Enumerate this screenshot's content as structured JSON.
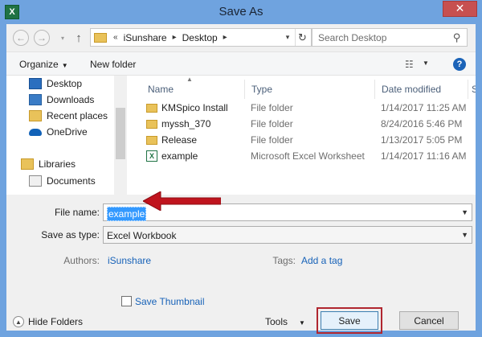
{
  "window": {
    "title": "Save As",
    "app_icon_letter": "X",
    "close_glyph": "✕"
  },
  "address": {
    "back_glyph": "←",
    "forward_glyph": "→",
    "up_glyph": "↑",
    "prefix": "«",
    "crumbs": [
      "iSunshare",
      "Desktop"
    ],
    "refresh_glyph": "↻",
    "search_placeholder": "Search Desktop"
  },
  "toolbar": {
    "organize": "Organize",
    "new_folder": "New folder",
    "help": "?"
  },
  "nav_pane": {
    "items": [
      {
        "label": "Desktop",
        "icon": "desktop-icon"
      },
      {
        "label": "Downloads",
        "icon": "downloads-icon"
      },
      {
        "label": "Recent places",
        "icon": "recent-places-icon"
      },
      {
        "label": "OneDrive",
        "icon": "onedrive-icon"
      },
      {
        "label": "Libraries",
        "icon": "libraries-icon"
      },
      {
        "label": "Documents",
        "icon": "documents-icon"
      }
    ]
  },
  "file_list": {
    "columns": [
      "Name",
      "Type",
      "Date modified",
      "Siz"
    ],
    "rows": [
      {
        "name": "KMSpico Install",
        "type": "File folder",
        "date": "1/14/2017 11:25 AM",
        "icon": "folder-icon"
      },
      {
        "name": "myssh_370",
        "type": "File folder",
        "date": "8/24/2016 5:46 PM",
        "icon": "folder-icon"
      },
      {
        "name": "Release",
        "type": "File folder",
        "date": "1/13/2017 5:05 PM",
        "icon": "folder-icon"
      },
      {
        "name": "example",
        "type": "Microsoft Excel Worksheet",
        "date": "1/14/2017 11:16 AM",
        "icon": "excel-file-icon"
      }
    ]
  },
  "form": {
    "file_name_label": "File name:",
    "file_name_value": "example",
    "save_as_type_label": "Save as type:",
    "save_as_type_value": "Excel Workbook",
    "authors_label": "Authors:",
    "authors_value": "iSunshare",
    "tags_label": "Tags:",
    "tags_value": "Add a tag",
    "save_thumbnail": "Save Thumbnail"
  },
  "footer": {
    "hide_folders": "Hide Folders",
    "tools": "Tools",
    "save": "Save",
    "cancel": "Cancel"
  },
  "colors": {
    "title_bg": "#6fa3df",
    "close_bg": "#c75050",
    "selection": "#3399ff",
    "highlight_outline": "#b0262f",
    "arrow": "#c0141e",
    "link": "#1762b8"
  }
}
